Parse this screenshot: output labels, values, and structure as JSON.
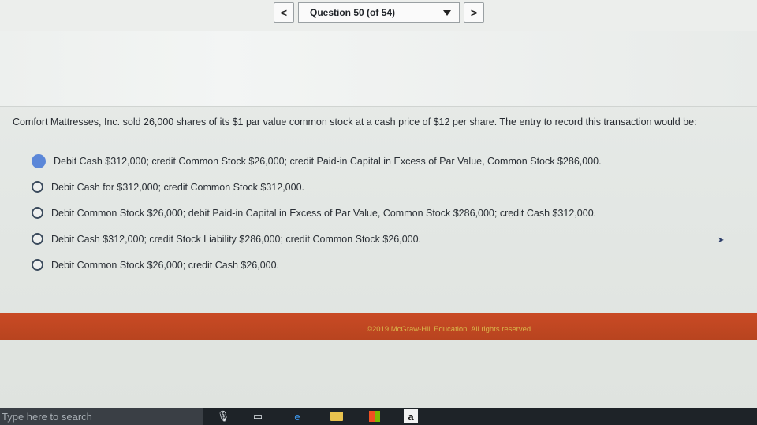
{
  "nav": {
    "prev_label": "<",
    "next_label": ">",
    "question_selector": "Question 50 (of 54)"
  },
  "question": {
    "text": "Comfort Mattresses, Inc. sold 26,000 shares of its $1 par value common stock at a cash price of $12 per share. The entry to record this transaction would be:"
  },
  "choices": [
    {
      "label": "Debit Cash $312,000; credit Common Stock $26,000; credit Paid-in Capital in Excess of Par Value, Common Stock $286,000.",
      "selected": true
    },
    {
      "label": "Debit Cash for $312,000; credit Common Stock $312,000.",
      "selected": false
    },
    {
      "label": "Debit Common Stock $26,000; debit Paid-in Capital in Excess of Par Value, Common Stock $286,000; credit Cash $312,000.",
      "selected": false
    },
    {
      "label": "Debit Cash $312,000; credit Stock Liability $286,000; credit Common Stock $26,000.",
      "selected": false
    },
    {
      "label": "Debit Common Stock $26,000; credit Cash $26,000.",
      "selected": false
    }
  ],
  "footer": {
    "copyright": "©2019 McGraw-Hill Education. All rights reserved."
  },
  "taskbar": {
    "search_placeholder": "Type here to search",
    "icons": [
      "microphone-icon",
      "task-view-icon",
      "edge-icon",
      "file-explorer-icon",
      "store-icon",
      "amazon-icon"
    ],
    "amazon_glyph": "a"
  },
  "colors": {
    "selected_radio": "#5b87d8",
    "footer_bar": "#c94a25",
    "taskbar": "#1e2328"
  }
}
